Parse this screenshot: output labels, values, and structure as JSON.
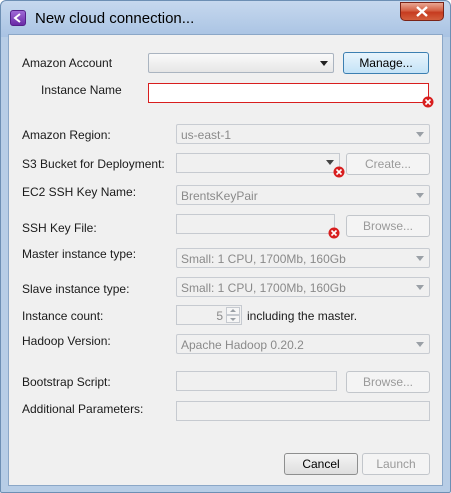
{
  "window": {
    "title": "New cloud connection..."
  },
  "labels": {
    "amazon_account": "Amazon Account",
    "instance_name": "Instance Name",
    "amazon_region": "Amazon Region:",
    "s3_bucket": "S3 Bucket for Deployment:",
    "ec2_key": "EC2 SSH Key Name:",
    "ssh_key_file": "SSH Key File:",
    "master_type": "Master instance type:",
    "slave_type": "Slave instance type:",
    "instance_count": "Instance count:",
    "including_master": "including the master.",
    "hadoop_version": "Hadoop Version:",
    "bootstrap_script": "Bootstrap Script:",
    "additional_params": "Additional Parameters:"
  },
  "values": {
    "amazon_account": "",
    "instance_name": "",
    "amazon_region": "us-east-1",
    "s3_bucket": "",
    "ec2_key": "BrentsKeyPair",
    "ssh_key_file": "",
    "master_type": "Small: 1 CPU, 1700Mb, 160Gb",
    "slave_type": "Small: 1 CPU, 1700Mb, 160Gb",
    "instance_count": "5",
    "hadoop_version": "Apache Hadoop 0.20.2",
    "bootstrap_script": "",
    "additional_params": ""
  },
  "buttons": {
    "manage": "Manage...",
    "create": "Create...",
    "browse_key": "Browse...",
    "browse_script": "Browse...",
    "cancel": "Cancel",
    "launch": "Launch"
  },
  "icons": {
    "app": "app-logo-icon",
    "close": "close-icon",
    "error": "error-icon",
    "dropdown": "dropdown-arrow-icon"
  },
  "colors": {
    "error": "#d81e1e",
    "title_bar": "#b7cde6",
    "close_button": "#c63b1f"
  }
}
